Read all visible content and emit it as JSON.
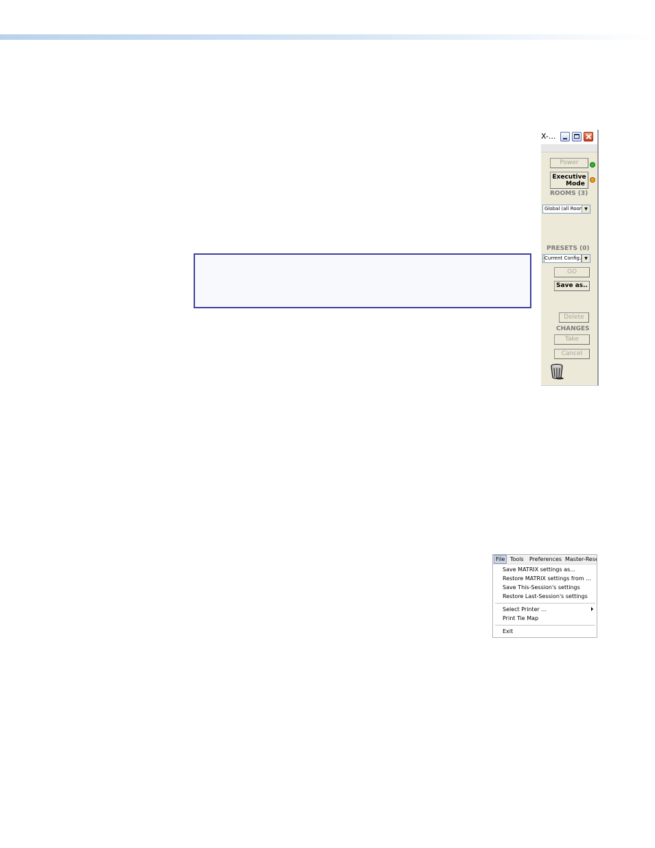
{
  "window": {
    "title": "X-...",
    "power_label": "Power",
    "executive_label_line1": "Executive",
    "executive_label_line2": "Mode",
    "rooms_label": "ROOMS (3)",
    "rooms_selected": "Global (all Room",
    "presets_label": "PRESETS (0)",
    "presets_selected": "Current Config.",
    "go_label": "GO",
    "saveas_label": "Save as..",
    "delete_label": "Delete",
    "changes_label": "CHANGES",
    "take_label": "Take",
    "cancel_label": "Cancel",
    "power_led_color": "#29b829",
    "executive_led_color": "#f29a18"
  },
  "file_menu": {
    "menubar": [
      "File",
      "Tools",
      "Preferences",
      "Master-Reset"
    ],
    "items": [
      "Save MATRIX settings as...",
      "Restore MATRIX settings from ...",
      "Save This-Session's settings",
      "Restore Last-Session's settings",
      "Select Printer ...",
      "Print Tie Map",
      "Exit"
    ]
  }
}
